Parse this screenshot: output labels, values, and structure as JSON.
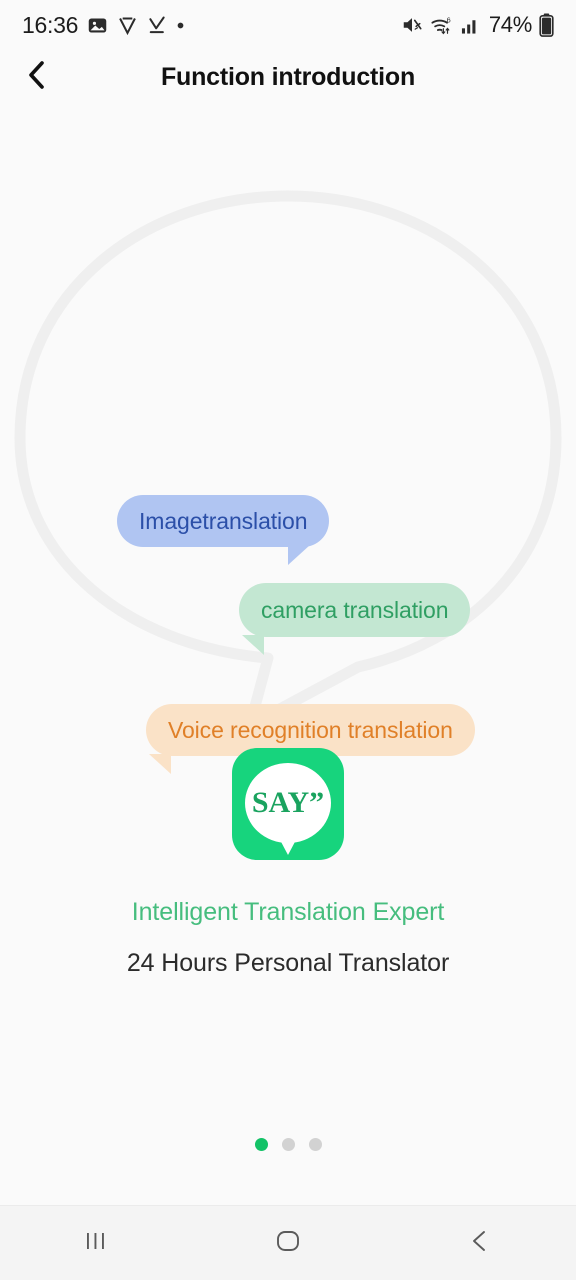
{
  "status_bar": {
    "time": "16:36",
    "left_icons": [
      "photo-icon",
      "v-app-icon",
      "download-check-icon",
      "dot-icon"
    ],
    "right_icons": [
      "mute-icon",
      "wifi-6-icon",
      "signal-bars-icon"
    ],
    "battery_percent": "74%",
    "battery_icon": "battery-icon"
  },
  "app_bar": {
    "back_icon": "back-chevron-icon",
    "title": "Function introduction"
  },
  "hero": {
    "outline_bubble_color": "#efefef",
    "bubbles": [
      {
        "label": "Imagetranslation",
        "bg": "#b0c5f2",
        "text_color": "#2b4fa8",
        "tail": "bottom-right"
      },
      {
        "label": "camera translation",
        "bg": "#c3e7d2",
        "text_color": "#2f9f63",
        "tail": "bottom-left"
      },
      {
        "label": "Voice recognition translation",
        "bg": "#fae2c7",
        "text_color": "#e08028",
        "tail": "bottom-left"
      }
    ]
  },
  "brand": {
    "icon_name": "say-app-icon",
    "icon_bg": "#17d47d",
    "icon_word": "SAY”",
    "tagline_primary": "Intelligent Translation Expert",
    "tagline_primary_color": "#46bd7e",
    "tagline_secondary": "24 Hours Personal Translator",
    "tagline_secondary_color": "#2b2b2b"
  },
  "pagination": {
    "total": 3,
    "active_index": 0,
    "active_color": "#13c267",
    "inactive_color": "#d2d2d2"
  },
  "nav_bar": {
    "recents_icon": "recents-icon",
    "home_icon": "home-icon",
    "back_icon": "nav-back-icon"
  }
}
